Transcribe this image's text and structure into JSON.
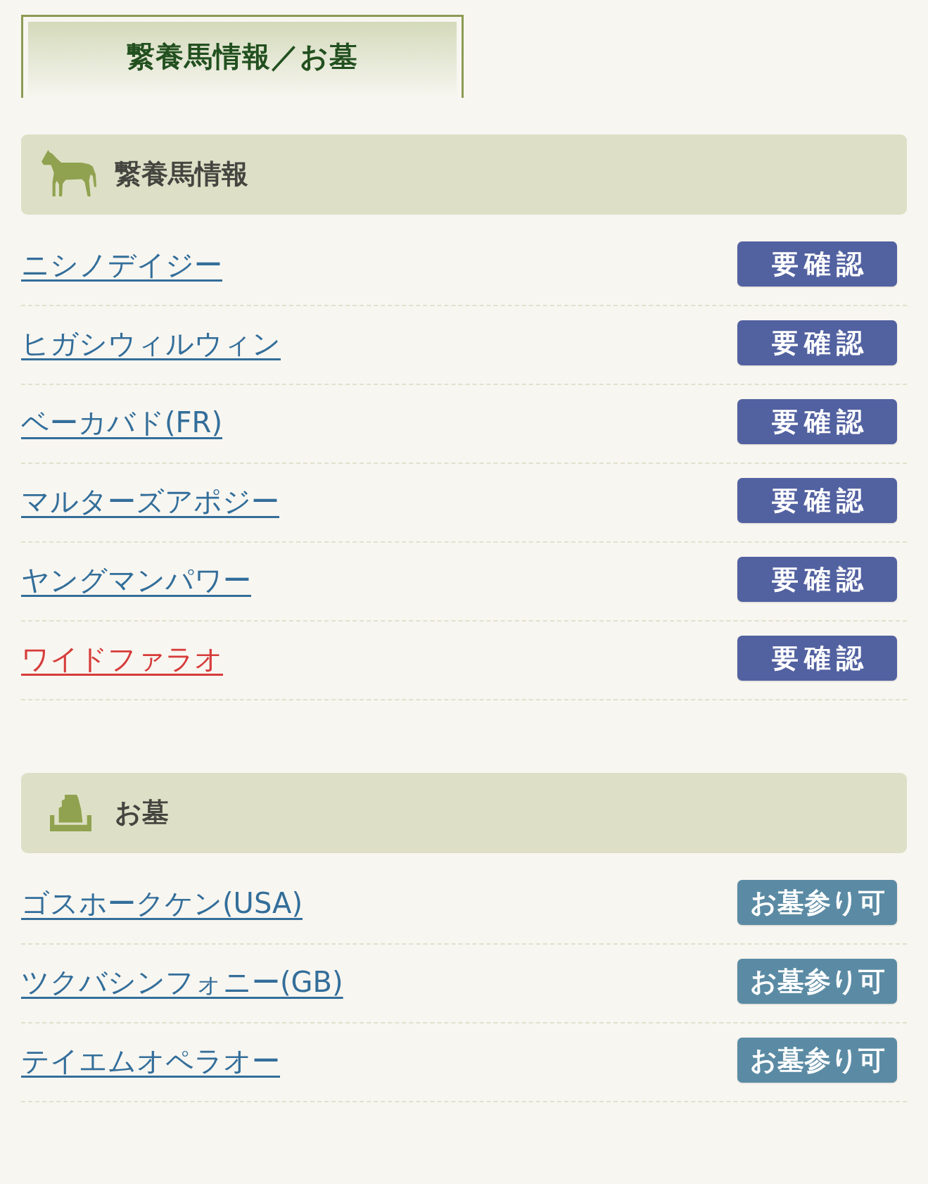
{
  "page_title": "繋養馬情報／お墓",
  "sections": [
    {
      "kind": "horse",
      "heading": "繋養馬情報",
      "items": [
        {
          "name": "ニシノデイジー",
          "color": "#336e9a",
          "badge": {
            "kind": "check",
            "text": "要確認"
          }
        },
        {
          "name": "ヒガシウィルウィン",
          "color": "#336e9a",
          "badge": {
            "kind": "check",
            "text": "要確認"
          }
        },
        {
          "name": "ベーカバド(FR)",
          "color": "#336e9a",
          "badge": {
            "kind": "check",
            "text": "要確認"
          }
        },
        {
          "name": "マルターズアポジー",
          "color": "#336e9a",
          "badge": {
            "kind": "check",
            "text": "要確認"
          }
        },
        {
          "name": "ヤングマンパワー",
          "color": "#336e9a",
          "badge": {
            "kind": "check",
            "text": "要確認"
          }
        },
        {
          "name": "ワイドファラオ",
          "color": "#d63c3a",
          "badge": {
            "kind": "check",
            "text": "要確認"
          }
        }
      ]
    },
    {
      "kind": "grave",
      "heading": "お墓",
      "items": [
        {
          "name": "ゴスホークケン(USA)",
          "color": "#336e9a",
          "badge": {
            "kind": "visit",
            "text": "お墓参り可"
          }
        },
        {
          "name": "ツクバシンフォニー(GB)",
          "color": "#336e9a",
          "badge": {
            "kind": "visit",
            "text": "お墓参り可"
          }
        },
        {
          "name": "テイエムオペラオー",
          "color": "#336e9a",
          "badge": {
            "kind": "visit",
            "text": "お墓参り可"
          }
        }
      ]
    }
  ]
}
